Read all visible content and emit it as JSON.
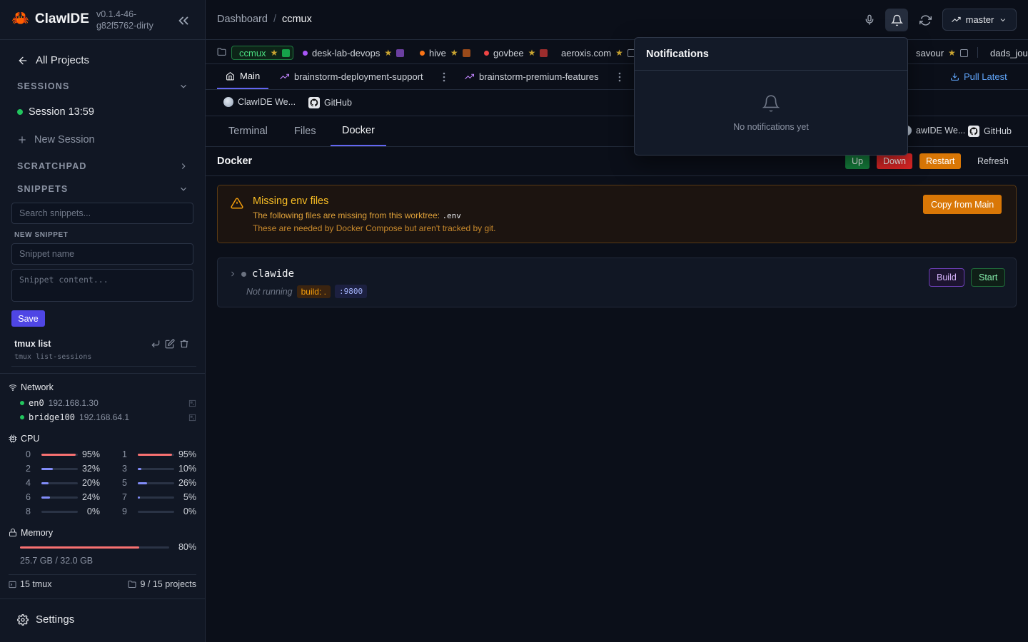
{
  "sidebar": {
    "brand": {
      "logo_glyph": "🦀",
      "name": "ClawIDE",
      "version_line1": "v0.1.4-46-",
      "version_line2": "g82f5762-dirty"
    },
    "all_projects": "All Projects",
    "sessions": {
      "heading": "SESSIONS",
      "items": [
        {
          "label": "Session 13:59",
          "status_color": "#22c55e"
        }
      ],
      "new_label": "New Session"
    },
    "scratchpad_heading": "SCRATCHPAD",
    "snippets": {
      "heading": "SNIPPETS",
      "search_placeholder": "Search snippets...",
      "new_label": "NEW SNIPPET",
      "name_placeholder": "Snippet name",
      "content_placeholder": "Snippet content...",
      "save_label": "Save",
      "items": [
        {
          "title": "tmux list",
          "command": "tmux list-sessions"
        }
      ]
    },
    "network": {
      "heading": "Network",
      "interfaces": [
        {
          "name": "en0",
          "ip": "192.168.1.30"
        },
        {
          "name": "bridge100",
          "ip": "192.168.64.1"
        }
      ]
    },
    "cpu": {
      "heading": "CPU",
      "cores": [
        {
          "index": "0",
          "percent": 95,
          "label": "95%"
        },
        {
          "index": "1",
          "percent": 95,
          "label": "95%"
        },
        {
          "index": "2",
          "percent": 32,
          "label": "32%"
        },
        {
          "index": "3",
          "percent": 10,
          "label": "10%"
        },
        {
          "index": "4",
          "percent": 20,
          "label": "20%"
        },
        {
          "index": "5",
          "percent": 26,
          "label": "26%"
        },
        {
          "index": "6",
          "percent": 24,
          "label": "24%"
        },
        {
          "index": "7",
          "percent": 5,
          "label": "5%"
        },
        {
          "index": "8",
          "percent": 0,
          "label": "0%"
        },
        {
          "index": "9",
          "percent": 0,
          "label": "0%"
        }
      ],
      "high_color": "#f87171",
      "normal_color": "#818cf8"
    },
    "memory": {
      "heading": "Memory",
      "percent": 80,
      "label": "80%",
      "detail": "25.7 GB / 32.0 GB"
    },
    "stats": {
      "tmux": "15 tmux",
      "projects": "9 / 15 projects"
    },
    "settings_label": "Settings"
  },
  "topbar": {
    "breadcrumb": {
      "root": "Dashboard",
      "separator": "/",
      "current": "ccmux"
    },
    "branch": "master"
  },
  "projects": [
    {
      "name": "ccmux",
      "dot_color": "",
      "square_color": "#16a34a",
      "active": true
    },
    {
      "name": "desk-lab-devops",
      "dot_color": "#a855f7",
      "square_color": "#6b3fa0",
      "active": false
    },
    {
      "name": "hive",
      "dot_color": "#f97316",
      "square_color": "#9a4a1a",
      "active": false
    },
    {
      "name": "govbee",
      "dot_color": "#ef4444",
      "square_color": "#9b2d2d",
      "active": false
    },
    {
      "name": "aeroxis.com",
      "dot_color": "",
      "square_color": "",
      "active": false
    },
    {
      "name": "savour",
      "dot_color": "",
      "square_color": "",
      "active": false
    },
    {
      "name": "dads_jou",
      "dot_color": "",
      "square_color": "",
      "active": false
    }
  ],
  "worktrees": {
    "items": [
      {
        "label": "Main",
        "icon": "home-icon",
        "active": true
      },
      {
        "label": "brainstorm-deployment-support",
        "icon": "trending-icon",
        "active": false
      },
      {
        "label": "brainstorm-premium-features",
        "icon": "trending-icon",
        "active": false
      }
    ],
    "pull_latest": "Pull Latest"
  },
  "links": [
    {
      "label": "ClawIDE We...",
      "icon": "globe-icon"
    },
    {
      "label": "GitHub",
      "icon": "github-icon"
    }
  ],
  "right_links": [
    {
      "label": "awIDE We...",
      "icon": "globe-icon"
    },
    {
      "label": "GitHub",
      "icon": "github-icon"
    }
  ],
  "view_tabs": [
    {
      "label": "Terminal",
      "active": false
    },
    {
      "label": "Files",
      "active": false
    },
    {
      "label": "Docker",
      "active": true
    }
  ],
  "docker": {
    "title": "Docker",
    "actions": {
      "up": "Up",
      "down": "Down",
      "restart": "Restart",
      "refresh": "Refresh"
    },
    "warning": {
      "title": "Missing env files",
      "line1_prefix": "The following files are missing from this worktree:",
      "line1_file": ".env",
      "line2": "These are needed by Docker Compose but aren't tracked by git.",
      "button": "Copy from Main"
    },
    "services": [
      {
        "name": "clawide",
        "status": "Not running",
        "build_tag": "build: .",
        "port": ":9800",
        "build_label": "Build",
        "start_label": "Start"
      }
    ]
  },
  "notifications": {
    "title": "Notifications",
    "empty_text": "No notifications yet"
  }
}
